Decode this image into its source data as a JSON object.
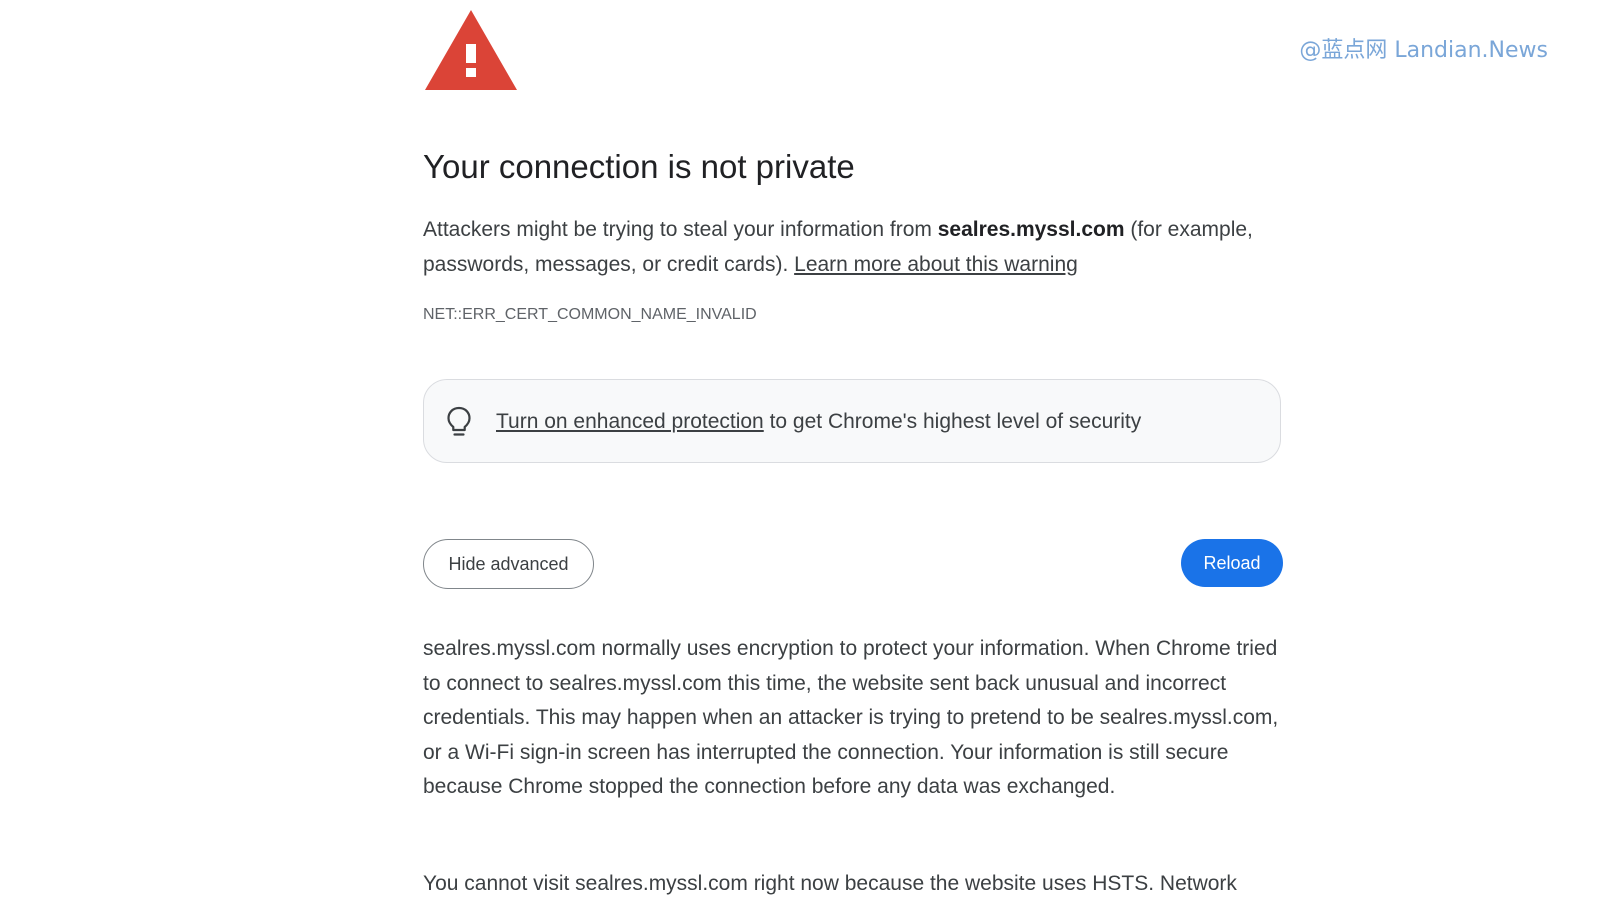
{
  "watermark": "@蓝点网 Landian.News",
  "icons": {
    "warning": "warning-triangle-icon",
    "bulb": "lightbulb-icon"
  },
  "colors": {
    "warning_red": "#db4437",
    "reload_blue": "#1a73e8",
    "watermark_blue": "#7aa6d8"
  },
  "title": "Your connection is not private",
  "intro": {
    "text_before": "Attackers might be trying to steal your information from ",
    "domain": "sealres.myssl.com",
    "text_after": " (for example, passwords, messages, or credit cards). ",
    "learn_more": "Learn more about this warning"
  },
  "error_code": "NET::ERR_CERT_COMMON_NAME_INVALID",
  "protection": {
    "link": "Turn on enhanced protection",
    "text": " to get Chrome's highest level of security"
  },
  "buttons": {
    "hide_advanced": "Hide advanced",
    "reload": "Reload"
  },
  "details": "sealres.myssl.com normally uses encryption to protect your information. When Chrome tried to connect to sealres.myssl.com this time, the website sent back unusual and incorrect credentials. This may happen when an attacker is trying to pretend to be sealres.myssl.com, or a Wi-Fi sign-in screen has interrupted the connection. Your information is still secure because Chrome stopped the connection before any data was exchanged.",
  "hsts": "You cannot visit sealres.myssl.com right now because the website uses HSTS. Network"
}
